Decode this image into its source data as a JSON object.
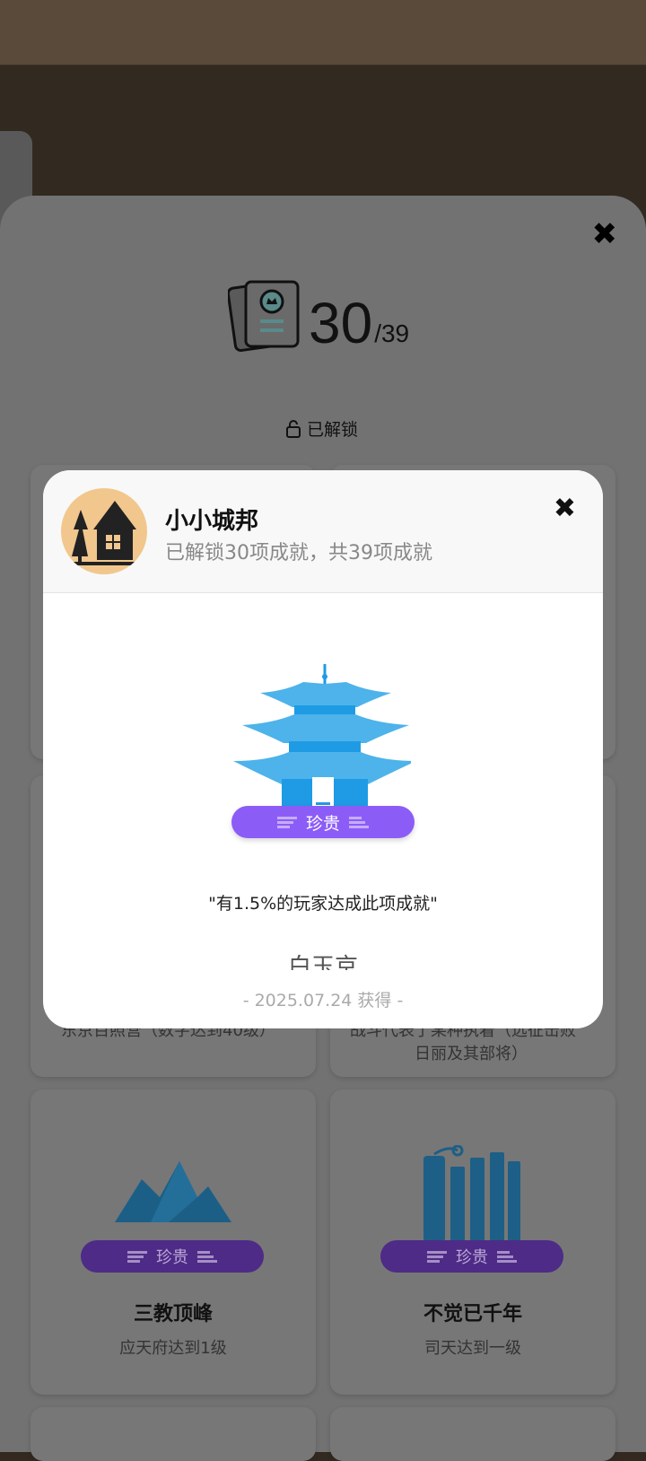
{
  "counter": {
    "unlocked": "30",
    "total": "/39"
  },
  "filter_label": "已解锁",
  "cards": [
    {
      "badge": "珍贵",
      "name": "三教顶峰",
      "desc": "应天府达到1级"
    },
    {
      "badge": "珍贵",
      "name": "不觉已千年",
      "desc": "司天达到一级"
    }
  ],
  "partial_texts": {
    "left": "东京百照营（数字达到40级）",
    "right1": "战斗代表了某种执着（远征击败",
    "right2": "日丽及其部将）"
  },
  "modal": {
    "title": "小小城邦",
    "subtitle": "已解锁30项成就，共39项成就",
    "badge": "珍贵",
    "quote": "\"有1.5%的玩家达成此项成就\"",
    "achievement_name": "白玉京",
    "date": "- 2025.07.24 获得 -"
  },
  "colors": {
    "accent": "#8c5cf7",
    "icon_blue": "#1e9be4"
  }
}
